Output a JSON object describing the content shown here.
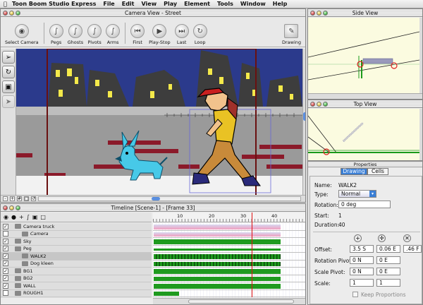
{
  "menubar": {
    "app": "Toon Boom Studio Express",
    "items": [
      "File",
      "Edit",
      "View",
      "Play",
      "Element",
      "Tools",
      "Window",
      "Help"
    ]
  },
  "camera_view": {
    "title": "Camera View - Street",
    "toolbar": {
      "select_camera": "Select Camera",
      "pegs": "Pegs",
      "ghosts": "Ghosts",
      "pivots": "Pivots",
      "arms": "Arms",
      "first": "First",
      "play_stop": "Play-Stop",
      "last": "Last",
      "loop": "Loop",
      "drawing": "Drawing"
    }
  },
  "side_view": {
    "title": "Side View"
  },
  "top_view": {
    "title": "Top View"
  },
  "timeline": {
    "title": "Timeline [Scene-1] - [Frame 33]",
    "ruler": [
      "10",
      "20",
      "30",
      "40"
    ],
    "current_frame": 33,
    "layers": [
      {
        "name": "Camera truck",
        "checked": true,
        "indent": 0,
        "selected": false
      },
      {
        "name": "Camera",
        "checked": false,
        "indent": 1,
        "selected": false
      },
      {
        "name": "Sky",
        "checked": true,
        "indent": 0,
        "selected": false
      },
      {
        "name": "Peg",
        "checked": true,
        "indent": 0,
        "selected": false
      },
      {
        "name": "WALK2",
        "checked": true,
        "indent": 1,
        "selected": true
      },
      {
        "name": "Dog kleen",
        "checked": true,
        "indent": 1,
        "selected": false
      },
      {
        "name": "BG1",
        "checked": true,
        "indent": 0,
        "selected": false
      },
      {
        "name": "BG2",
        "checked": true,
        "indent": 0,
        "selected": false
      },
      {
        "name": "WALL",
        "checked": true,
        "indent": 0,
        "selected": false
      },
      {
        "name": "ROUGH1",
        "checked": false,
        "indent": 0,
        "selected": false
      }
    ]
  },
  "properties": {
    "title": "Properties",
    "tabs": [
      "Drawing",
      "Cells"
    ],
    "active_tab": "Drawing",
    "name_label": "Name:",
    "name_value": "WALK2",
    "type_label": "Type:",
    "type_value": "Normal",
    "rotation_label": "Rotation:",
    "rotation_value": "0 deg",
    "start_label": "Start:",
    "start_value": "1",
    "duration_label": "Duration:",
    "duration_value": "40",
    "offset_label": "Offset:",
    "offset_values": [
      "3.5 S",
      "0.06 E",
      ".46 F"
    ],
    "rotation_pivot_label": "Rotation Pivot:",
    "rotation_pivot_values": [
      "0 N",
      "0 E"
    ],
    "scale_pivot_label": "Scale Pivot:",
    "scale_pivot_values": [
      "0 N",
      "0 E"
    ],
    "scale_label": "Scale:",
    "scale_values": [
      "1",
      "1"
    ],
    "keep_proportions": "Keep Proportions"
  },
  "colors": {
    "sky": "#2b3a8c",
    "building": "#3d3d3d",
    "window": "#f4e94a",
    "wall": "#9a9a9a",
    "brick": "#8b1a2a",
    "dog": "#47c9e8",
    "track_green": "#1f9a1f",
    "playhead": "#e01010",
    "tab_active": "#3a7fd6"
  }
}
